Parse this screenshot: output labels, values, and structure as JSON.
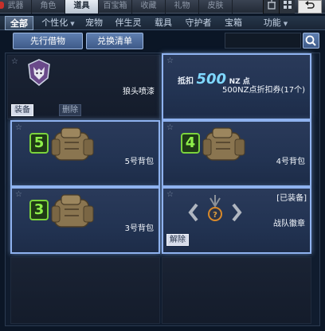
{
  "top_tabs": [
    "武器",
    "角色",
    "道具",
    "百宝箱",
    "收藏",
    "礼物",
    "皮肤"
  ],
  "active_top_tab": "道具",
  "categories": [
    {
      "label": "全部",
      "dropdown": false
    },
    {
      "label": "个性化",
      "dropdown": true
    },
    {
      "label": "宠物",
      "dropdown": false
    },
    {
      "label": "伴生灵",
      "dropdown": false
    },
    {
      "label": "载具",
      "dropdown": false
    },
    {
      "label": "守护者",
      "dropdown": false
    },
    {
      "label": "宝箱",
      "dropdown": false
    },
    {
      "label": "功能",
      "dropdown": true
    }
  ],
  "actions": {
    "borrow": "先行借物",
    "exchange": "兑换清单"
  },
  "search": {
    "placeholder": ""
  },
  "items": [
    {
      "name": "狼头喷漆",
      "icon": "wolf-emblem-icon",
      "buttons": [
        "装备",
        "删除"
      ]
    },
    {
      "name": "500NZ点折扣券(17个)",
      "icon": "coupon-icon",
      "coupon": {
        "pre": "抵扣",
        "value": "500",
        "post": "NZ 点"
      }
    },
    {
      "name": "5号背包",
      "badge": "5",
      "icon": "backpack-icon"
    },
    {
      "name": "4号背包",
      "badge": "4",
      "icon": "backpack-icon"
    },
    {
      "name": "3号背包",
      "badge": "3",
      "icon": "backpack-icon"
    },
    {
      "name": "战队徽章",
      "tag": "[已装备]",
      "icon": "team-badge-icon",
      "buttons": [
        "解除"
      ]
    }
  ],
  "colors": {
    "accent": "#6a84b4",
    "badge_green": "#7bd33c",
    "coupon_blue": "#7fd8ff"
  }
}
